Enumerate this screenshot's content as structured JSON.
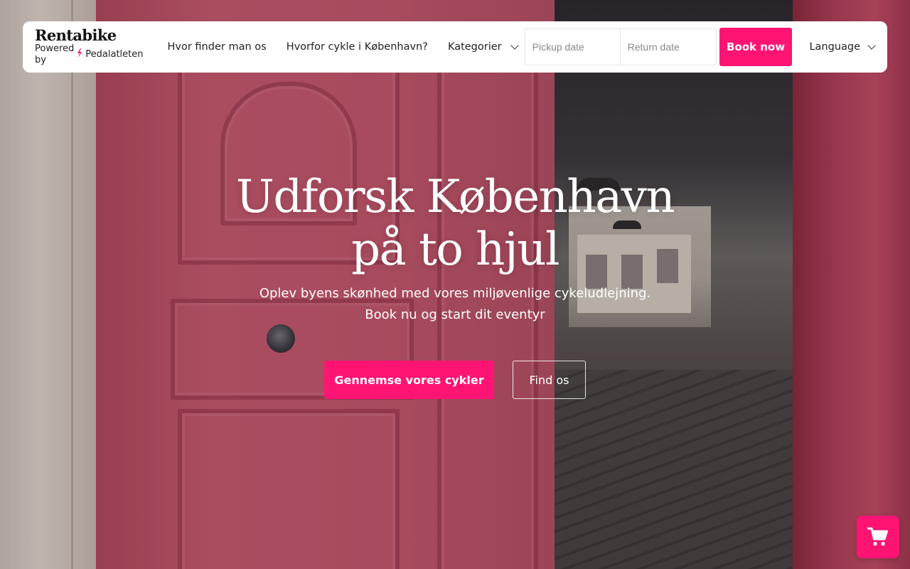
{
  "brand": {
    "name": "Rentabike",
    "powered_by": "Powered by",
    "partner": "Pedalatleten"
  },
  "nav": {
    "links": [
      "Hvor finder man os",
      "Hvorfor cykle i København?"
    ],
    "dropdown_label": "Kategorier",
    "pickup_placeholder": "Pickup date",
    "return_placeholder": "Return date",
    "book_label": "Book now",
    "language_label": "Language"
  },
  "hero": {
    "title_line1": "Udforsk København",
    "title_line2": "på to hjul",
    "subtitle_line1": "Oplev byens skønhed med vores miljøvenlige cykeludlejning.",
    "subtitle_line2": "Book nu og start dit eventyr",
    "primary_cta": "Gennemse vores cykler",
    "secondary_cta": "Find os"
  },
  "colors": {
    "accent": "#ff1474",
    "navbar_bg": "#ffffff",
    "text_dark": "#222222"
  },
  "icons": {
    "cart": "shopping-cart-icon",
    "bolt": "lightning-bolt-icon",
    "chevron": "chevron-down-icon"
  }
}
